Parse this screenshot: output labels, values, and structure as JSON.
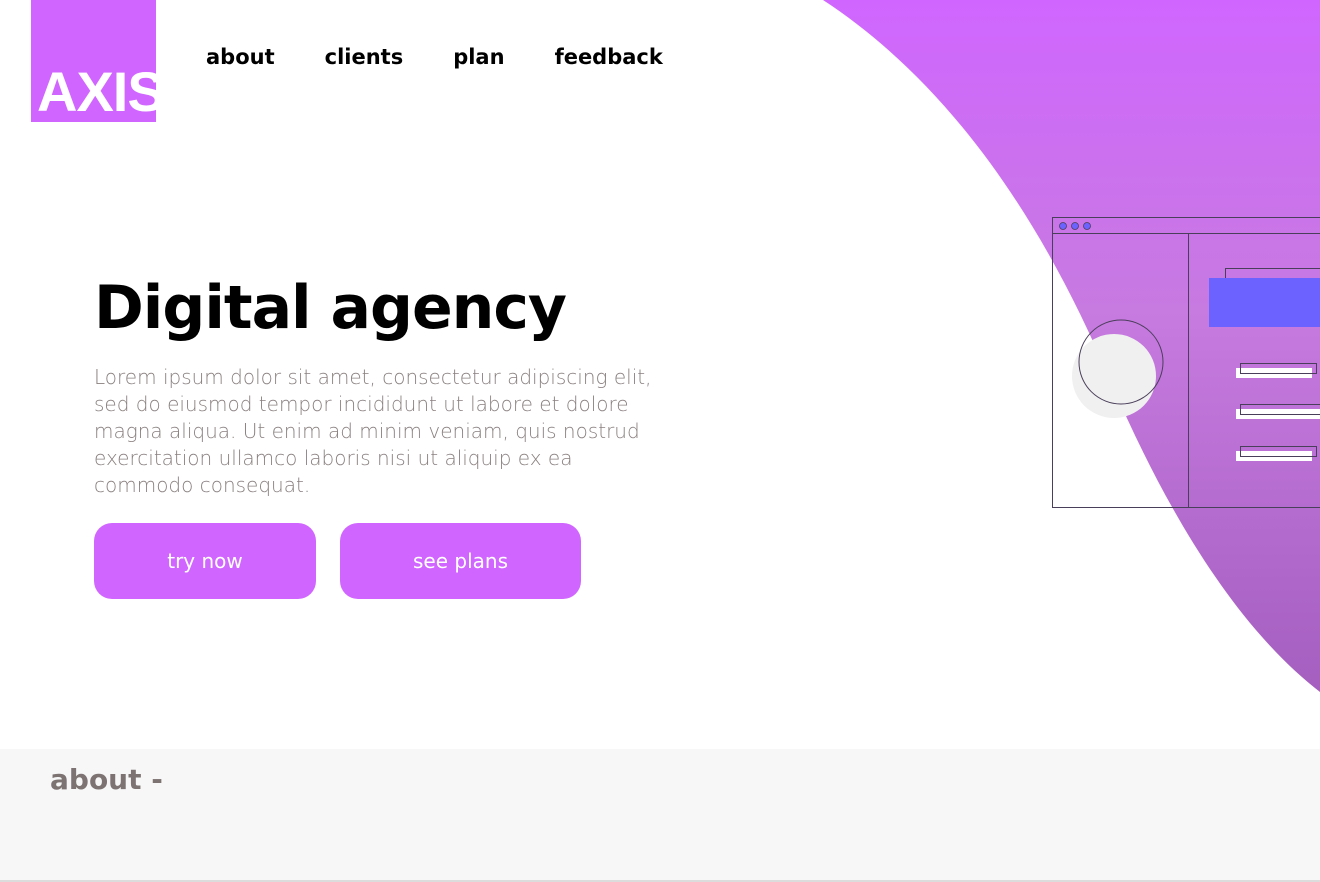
{
  "brand": {
    "logo_text": "AXIS",
    "accent_color": "#d066ff",
    "gradient_bottom": "#a45fbf"
  },
  "nav": {
    "items": [
      "about",
      "clients",
      "plan",
      "feedback"
    ]
  },
  "hero": {
    "headline": "Digital agency",
    "lead": "Lorem ipsum dolor sit amet, consectetur adipiscing elit, sed do eiusmod tempor incididunt ut labore et dolore magna aliqua. Ut enim ad minim veniam, quis nostrud exercitation ullamco laboris nisi ut aliquip ex ea commodo consequat.",
    "try_now_label": "try now",
    "see_plans_label": "see plans"
  },
  "about": {
    "title": "about -"
  }
}
